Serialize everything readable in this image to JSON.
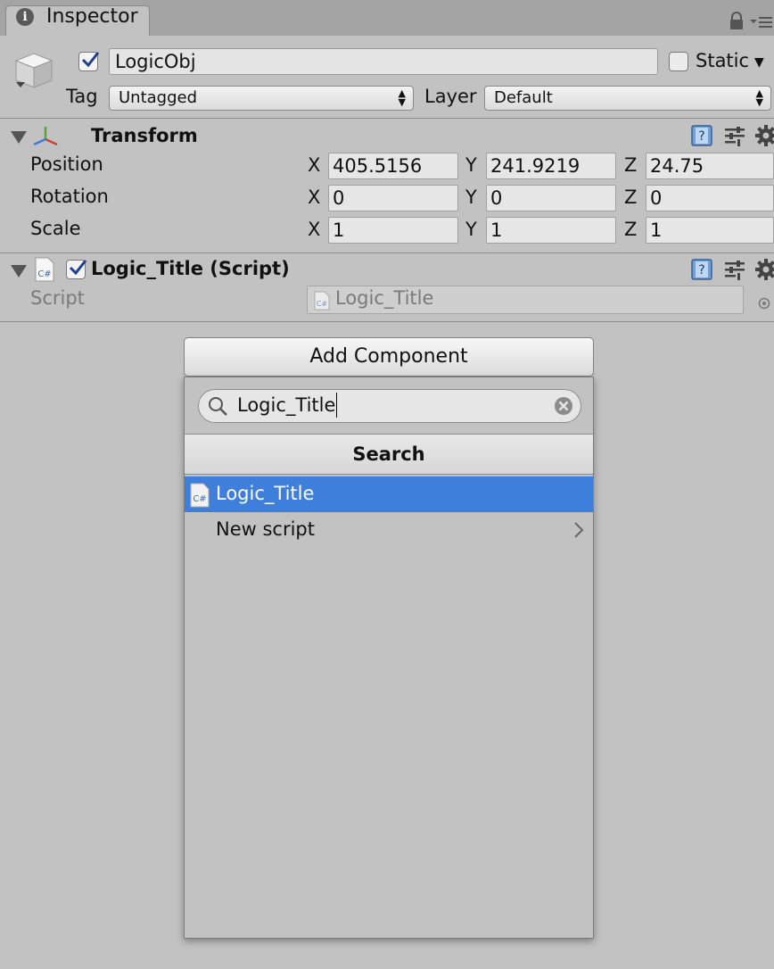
{
  "tab": {
    "title": "Inspector"
  },
  "object": {
    "active": true,
    "name": "LogicObj",
    "static_label": "Static",
    "static_checked": false
  },
  "tag": {
    "label": "Tag",
    "value": "Untagged"
  },
  "layer": {
    "label": "Layer",
    "value": "Default"
  },
  "transform": {
    "title": "Transform",
    "rows": [
      {
        "label": "Position",
        "x": "405.5156",
        "y": "241.9219",
        "z": "24.75"
      },
      {
        "label": "Rotation",
        "x": "0",
        "y": "0",
        "z": "0"
      },
      {
        "label": "Scale",
        "x": "1",
        "y": "1",
        "z": "1"
      }
    ],
    "axes": {
      "x": "X",
      "y": "Y",
      "z": "Z"
    }
  },
  "script_component": {
    "title": "Logic_Title (Script)",
    "enabled": true,
    "field_label": "Script",
    "field_value": "Logic_Title",
    "cs_icon_text": "C#"
  },
  "add_component": {
    "button_label": "Add Component",
    "search_value": "Logic_Title",
    "section_header": "Search",
    "results": [
      {
        "label": "Logic_Title",
        "selected": true
      },
      {
        "label": "New script",
        "selected": false
      }
    ]
  },
  "colors": {
    "selection": "#3d7fdb",
    "panel": "#c2c2c2"
  }
}
